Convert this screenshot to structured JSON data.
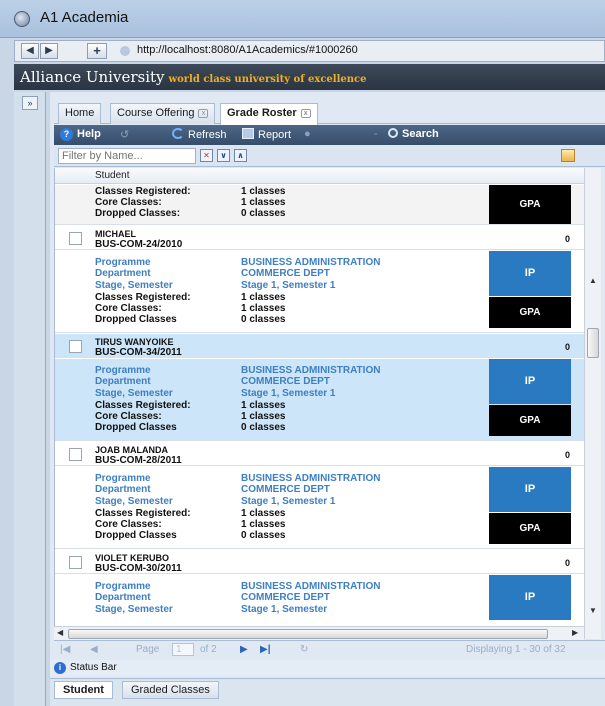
{
  "window": {
    "title": "A1 Academia",
    "url_prefix": "http://",
    "url": "localhost:8080/A1Academics/#1000260"
  },
  "banner": {
    "title": "Alliance University",
    "tagline": "world class university of excellence"
  },
  "tabs": [
    {
      "label": "Home"
    },
    {
      "label": "Course Offering"
    },
    {
      "label": "Grade Roster"
    }
  ],
  "toolbar": {
    "help": "Help",
    "refresh": "Refresh",
    "report": "Report",
    "search": "Search"
  },
  "filter": {
    "placeholder": "Filter by Name..."
  },
  "grid": {
    "column": "Student",
    "labels": {
      "programme": "Programme",
      "department": "Department",
      "stage": "Stage, Semester",
      "registered": "Classes Registered:",
      "core": "Core Classes:",
      "dropped_colon": "Dropped Classes:",
      "dropped": "Dropped Classes"
    },
    "ip": "IP",
    "gpa": "GPA",
    "partial_top": {
      "registered": "1 classes",
      "core": "1 classes",
      "dropped": "0 classes"
    },
    "students": [
      {
        "name": "MICHAEL",
        "reg": "BUS-COM-24/2010",
        "score": "0",
        "programme": "BUSINESS ADMINISTRATION",
        "department": "COMMERCE DEPT",
        "stage": "Stage 1, Semester 1",
        "registered": "1 classes",
        "core": "1 classes",
        "dropped": "0 classes"
      },
      {
        "name": "TIRUS WANYOIKE",
        "reg": "BUS-COM-34/2011",
        "score": "0",
        "programme": "BUSINESS ADMINISTRATION",
        "department": "COMMERCE DEPT",
        "stage": "Stage 1, Semester 1",
        "registered": "1 classes",
        "core": "1 classes",
        "dropped": "0 classes"
      },
      {
        "name": "JOAB MALANDA",
        "reg": "BUS-COM-28/2011",
        "score": "0",
        "programme": "BUSINESS ADMINISTRATION",
        "department": "COMMERCE DEPT",
        "stage": "Stage 1, Semester 1",
        "registered": "1 classes",
        "core": "1 classes",
        "dropped": "0 classes"
      },
      {
        "name": "VIOLET KERUBO",
        "reg": "BUS-COM-30/2011",
        "score": "0",
        "programme": "BUSINESS ADMINISTRATION",
        "department": "COMMERCE DEPT",
        "stage": "Stage 1, Semester"
      }
    ]
  },
  "pager": {
    "page_label": "Page",
    "page_value": "1",
    "of_label": "of 2",
    "displaying": "Displaying 1 - 30 of 32"
  },
  "status": {
    "text": "Status Bar"
  },
  "bottom_tabs": [
    {
      "label": "Student"
    },
    {
      "label": "Graded Classes"
    }
  ]
}
